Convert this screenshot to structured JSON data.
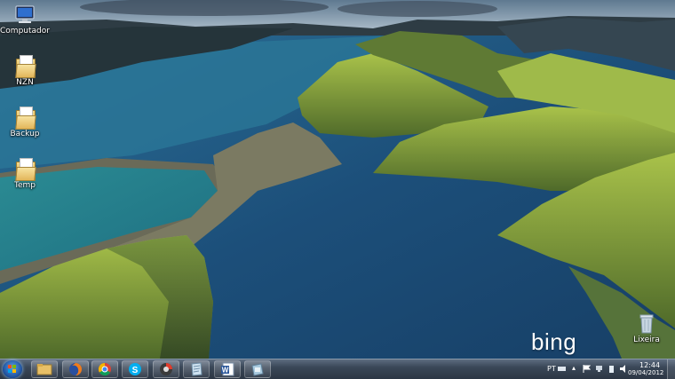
{
  "desktop": {
    "icons": [
      {
        "label": "Computador"
      },
      {
        "label": "NZN"
      },
      {
        "label": "Backup"
      },
      {
        "label": "Temp"
      },
      {
        "label": "Lixeira"
      }
    ],
    "watermark": "bing"
  },
  "taskbar": {
    "apps": [
      {
        "name": "windows-explorer"
      },
      {
        "name": "firefox"
      },
      {
        "name": "chrome"
      },
      {
        "name": "skype"
      },
      {
        "name": "media-app"
      },
      {
        "name": "document-app"
      },
      {
        "name": "word"
      },
      {
        "name": "utility-app"
      }
    ],
    "tray": {
      "language": "PT",
      "time": "12:44",
      "date": "09/04/2012"
    }
  },
  "colors": {
    "taskbar": "#34404f",
    "water": "#1d4e78",
    "hills": "#7fa436",
    "sky": "#8ea6b9"
  }
}
